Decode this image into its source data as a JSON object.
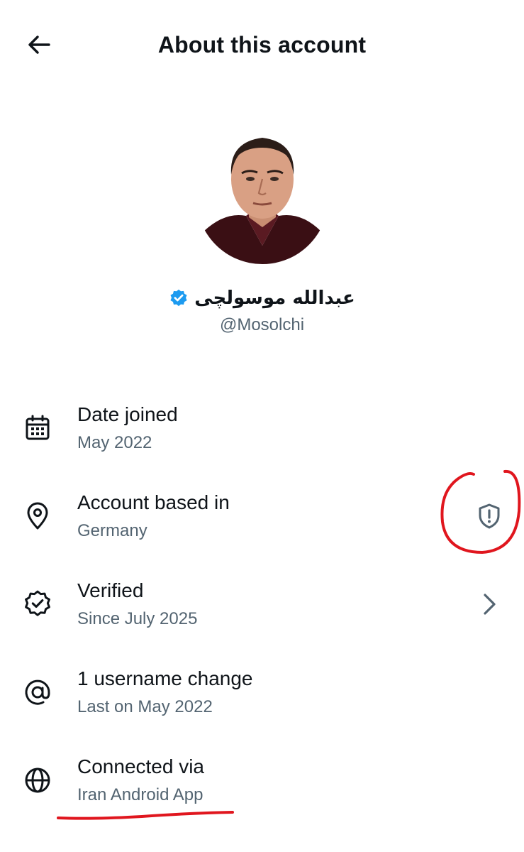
{
  "header": {
    "title": "About this account",
    "back_icon": "arrow-left-icon"
  },
  "profile": {
    "display_name": "عبدالله موسولچی",
    "handle": "@Mosolchi",
    "verified_icon": "verified-badge-icon",
    "verified_color": "#1d9bf0"
  },
  "rows": [
    {
      "icon": "calendar-icon",
      "label": "Date joined",
      "value": "May 2022"
    },
    {
      "icon": "location-pin-icon",
      "label": "Account based in",
      "value": "Germany",
      "trailing_icon": "shield-alert-icon"
    },
    {
      "icon": "verified-seal-icon",
      "label": "Verified",
      "value": "Since July 2025",
      "trailing_icon": "chevron-right-icon"
    },
    {
      "icon": "at-sign-icon",
      "label": "1 username change",
      "value": "Last on May 2022"
    },
    {
      "icon": "globe-icon",
      "label": "Connected via",
      "value": "Iran Android App"
    }
  ],
  "annotation_color": "#e0161e",
  "colors": {
    "text_primary": "#0f1419",
    "text_secondary": "#536471"
  }
}
